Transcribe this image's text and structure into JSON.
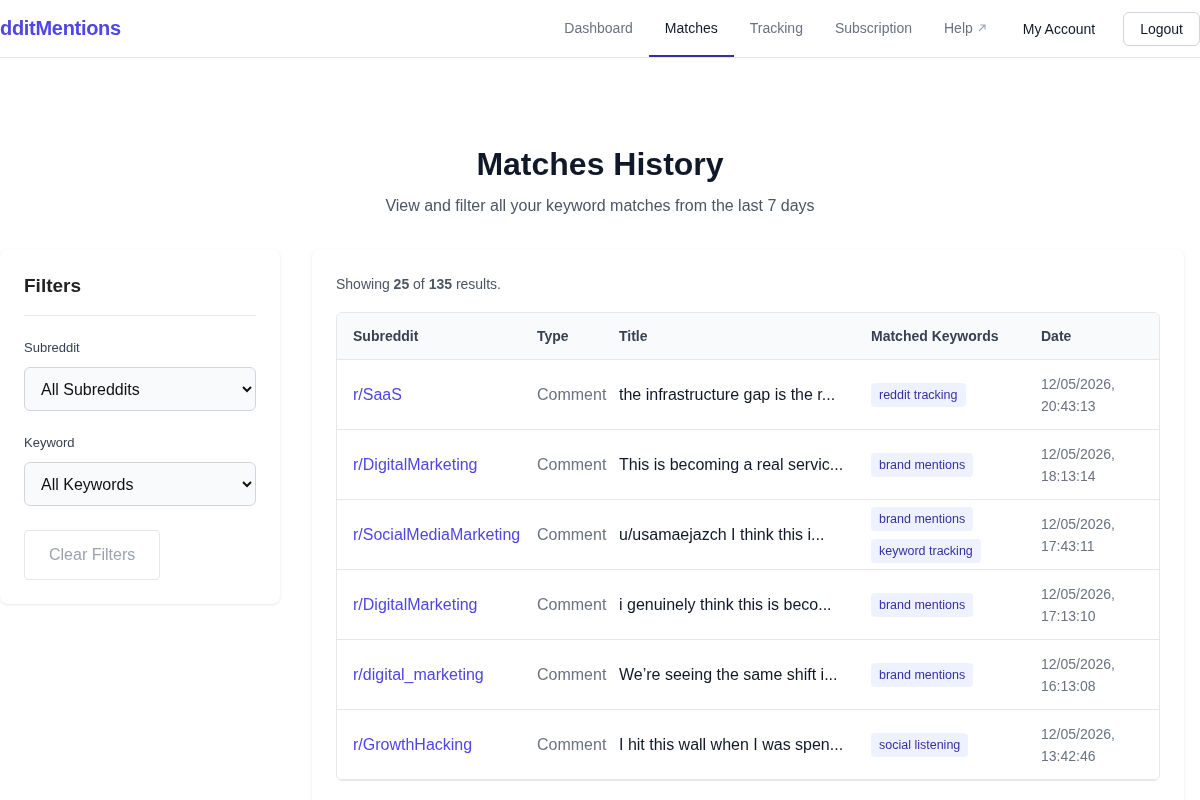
{
  "brand": "dditMentions",
  "nav": [
    {
      "label": "Dashboard",
      "selected": false,
      "external": false
    },
    {
      "label": "Matches",
      "selected": true,
      "external": false
    },
    {
      "label": "Tracking",
      "selected": false,
      "external": false
    },
    {
      "label": "Subscription",
      "selected": false,
      "external": false
    },
    {
      "label": "Help",
      "selected": false,
      "external": true
    }
  ],
  "account": "My Account",
  "logout": "Logout",
  "heading": "Matches History",
  "subheading": "View and filter all your keyword matches from the last 7 days",
  "filters": {
    "title": "Filters",
    "fields": [
      {
        "label": "Subreddit",
        "value": "All Subreddits"
      },
      {
        "label": "Keyword",
        "value": "All Keywords"
      }
    ],
    "clear": {
      "label": "Clear Filters",
      "disabled": true
    }
  },
  "summary": "Showing **25** of **135** results.",
  "table": {
    "columns": [
      "Subreddit",
      "Type",
      "Title",
      "Matched Keywords",
      "Date"
    ],
    "rows": [
      {
        "subreddit": "r/SaaS",
        "type": "Comment",
        "title": "the infrastructure gap is the r...",
        "keywords": [
          "reddit tracking"
        ],
        "date": [
          "12/05/2026,",
          "20:43:13"
        ]
      },
      {
        "subreddit": "r/DigitalMarketing",
        "type": "Comment",
        "title": "This is becoming a real servic...",
        "keywords": [
          "brand mentions"
        ],
        "date": [
          "12/05/2026,",
          "18:13:14"
        ]
      },
      {
        "subreddit": "r/SocialMediaMarketing",
        "type": "Comment",
        "title": "u/usamaejazch I think this i...",
        "keywords": [
          "brand mentions",
          "keyword tracking"
        ],
        "date": [
          "12/05/2026,",
          "17:43:11"
        ]
      },
      {
        "subreddit": "r/DigitalMarketing",
        "type": "Comment",
        "title": "i genuinely think this is beco...",
        "keywords": [
          "brand mentions"
        ],
        "date": [
          "12/05/2026,",
          "17:13:10"
        ]
      },
      {
        "subreddit": "r/digital_marketing",
        "type": "Comment",
        "title": "We’re seeing the same shift i...",
        "keywords": [
          "brand mentions"
        ],
        "date": [
          "12/05/2026,",
          "16:13:08"
        ]
      },
      {
        "subreddit": "r/GrowthHacking",
        "type": "Comment",
        "title": "I hit this wall when I was spen...",
        "keywords": [
          "social listening"
        ],
        "date": [
          "12/05/2026,",
          "13:42:46"
        ]
      }
    ]
  }
}
